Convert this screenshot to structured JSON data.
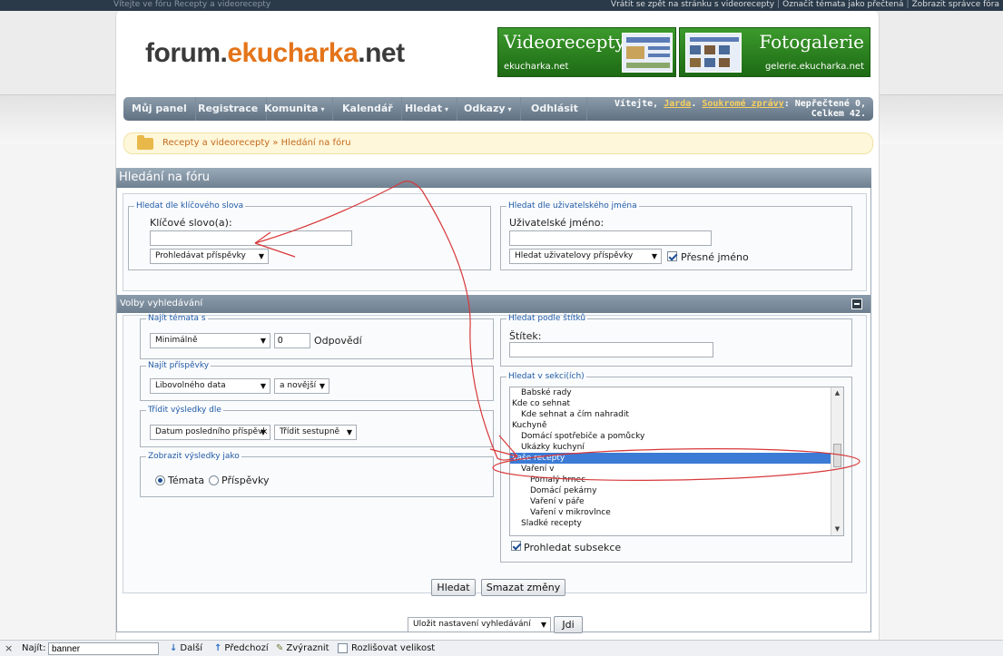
{
  "topbar": {
    "welcome": "Vítejte ve fóru Recepty a videorecepty",
    "links": [
      "Vrátit se zpět na stránku s videorecepty",
      "Označit témata jako přečtená",
      "Zobrazit správce fóra"
    ]
  },
  "logo": {
    "part1": "forum.",
    "part2": "ekucharka",
    "part3": ".net"
  },
  "banners": [
    {
      "title": "Videorecepty",
      "subtitle": "ekucharka.net"
    },
    {
      "title": "Fotogalerie",
      "subtitle": "gelerie.ekucharka.net"
    }
  ],
  "nav": {
    "items": [
      "Můj panel",
      "Registrace",
      "Komunita",
      "Kalendář",
      "Hledat",
      "Odkazy",
      "Odhlásit"
    ],
    "caret": "▾",
    "greeting": "Vítejte, ",
    "username": "Jarda",
    "pm_link": "Soukromé zprávy",
    "pm_status_1": ": Nepřečtené 0,",
    "pm_status_2": "Celkem 42."
  },
  "breadcrumb": {
    "text": "Recepty a videorecepty » Hledání na fóru"
  },
  "page_title": "Hledání na fóru",
  "keyword": {
    "legend": "Hledat dle klíčového slova",
    "label": "Klíčové slovo(a):",
    "value": "",
    "scope": "Prohledávat příspěvky"
  },
  "username_search": {
    "legend": "Hledat dle uživatelského jména",
    "label": "Uživatelské jméno:",
    "value": "",
    "scope": "Hledat uživatelovy příspěvky",
    "exact_label": "Přesné jméno",
    "exact_checked": true
  },
  "options": {
    "title": "Volby vyhledávání",
    "find_threads": {
      "legend": "Najít témata s",
      "mode": "Minimálně",
      "count": "0",
      "suffix": "Odpovědí"
    },
    "find_posts": {
      "legend": "Najít příspěvky",
      "date": "Libovolného data",
      "direction": "a novější"
    },
    "sort": {
      "legend": "Třídit výsledky dle",
      "field": "Datum posledního příspěvk",
      "order": "Třídit sestupně"
    },
    "show_as": {
      "legend": "Zobrazit výsledky jako",
      "threads": "Témata",
      "posts": "Příspěvky",
      "selected": "threads"
    },
    "tags": {
      "legend": "Hledat podle štítků",
      "label": "Štítek:",
      "value": ""
    },
    "sections": {
      "legend": "Hledat v sekci(ích)",
      "items": [
        {
          "label": "Babské rady",
          "indent": 1
        },
        {
          "label": "Kde co sehnat",
          "indent": 0
        },
        {
          "label": "Kde sehnat a čím nahradit",
          "indent": 1
        },
        {
          "label": "Kuchyně",
          "indent": 0
        },
        {
          "label": "Domácí spotřebiče a pomůcky",
          "indent": 1
        },
        {
          "label": "Ukázky kuchyní",
          "indent": 1
        },
        {
          "label": "Vaše recepty",
          "indent": 0,
          "selected": true
        },
        {
          "label": "Vaření v",
          "indent": 1
        },
        {
          "label": "Pomalý hrnec",
          "indent": 2
        },
        {
          "label": "Domácí pekárny",
          "indent": 2
        },
        {
          "label": "Vaření v páře",
          "indent": 2
        },
        {
          "label": "Vaření v mikrovlnce",
          "indent": 2
        },
        {
          "label": "Sladké recepty",
          "indent": 1
        }
      ],
      "subsections_label": "Prohledat subsekce",
      "subsections_checked": true
    }
  },
  "buttons": {
    "search": "Hledat",
    "reset": "Smazat změny",
    "save_select": "Uložit nastavení vyhledávání",
    "go": "Jdi"
  },
  "findbar": {
    "close": "×",
    "label": "Najít:",
    "value": "banner",
    "next": "Další",
    "prev": "Předchozí",
    "highlight": "Zvýraznit",
    "match_case": "Rozlišovat velikost"
  }
}
